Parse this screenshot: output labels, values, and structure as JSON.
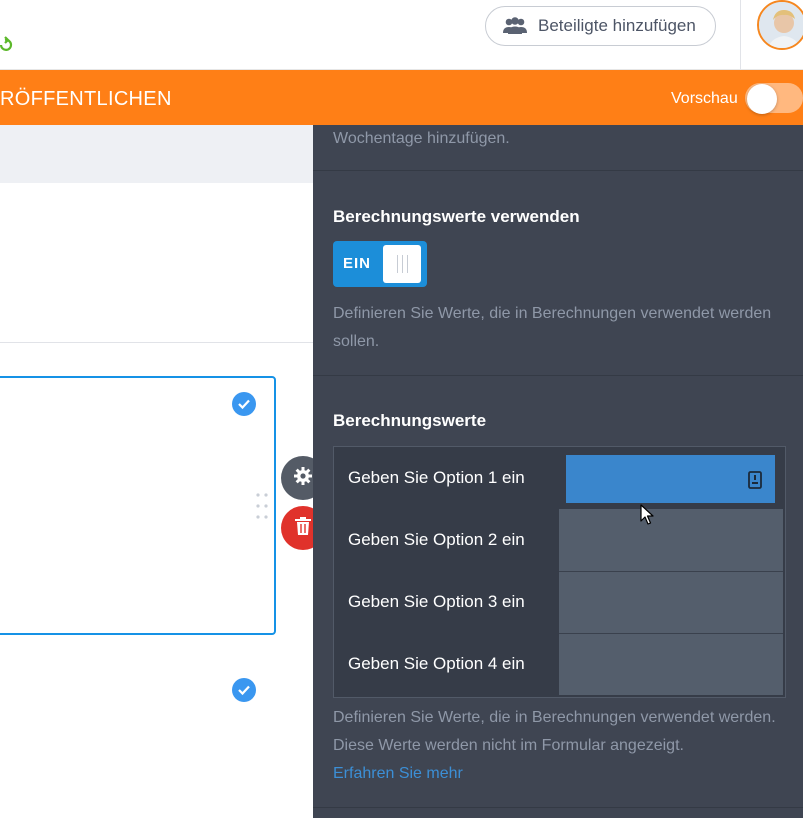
{
  "topbar": {
    "invite_label": "Beteiligte hinzufügen"
  },
  "orangebar": {
    "publish_label": "RÖFFENTLICHEN",
    "preview_label": "Vorschau",
    "preview_enabled": false
  },
  "panel": {
    "weekdays_hint": "Wochentage hinzufügen.",
    "calc_values_toggle": {
      "title": "Berechnungswerte verwenden",
      "state_label": "EIN",
      "enabled": true,
      "description": "Definieren Sie Werte, die in Berechnungen verwendet werden sollen."
    },
    "calc_values": {
      "title": "Berechnungswerte",
      "options": [
        {
          "label": "Geben Sie Option 1 ein",
          "value": ""
        },
        {
          "label": "Geben Sie Option 2 ein",
          "value": ""
        },
        {
          "label": "Geben Sie Option 3 ein",
          "value": ""
        },
        {
          "label": "Geben Sie Option 4 ein",
          "value": ""
        }
      ],
      "description": "Definieren Sie Werte, die in Berechnungen verwendet werden. Diese Werte werden nicht im Formular angezeigt.",
      "learn_more": "Erfahren Sie mehr"
    }
  },
  "colors": {
    "brand_orange": "#ff7f16",
    "panel_bg": "#3f4552",
    "toggle_blue": "#1c8ed9",
    "link_blue": "#3c8fd6",
    "delete_red": "#e0322b"
  },
  "icons": [
    "undo-icon",
    "people-icon",
    "avatar",
    "check-icon",
    "gear-icon",
    "trash-icon",
    "drag-handle-icon",
    "keyboard-icon",
    "mouse-cursor"
  ]
}
